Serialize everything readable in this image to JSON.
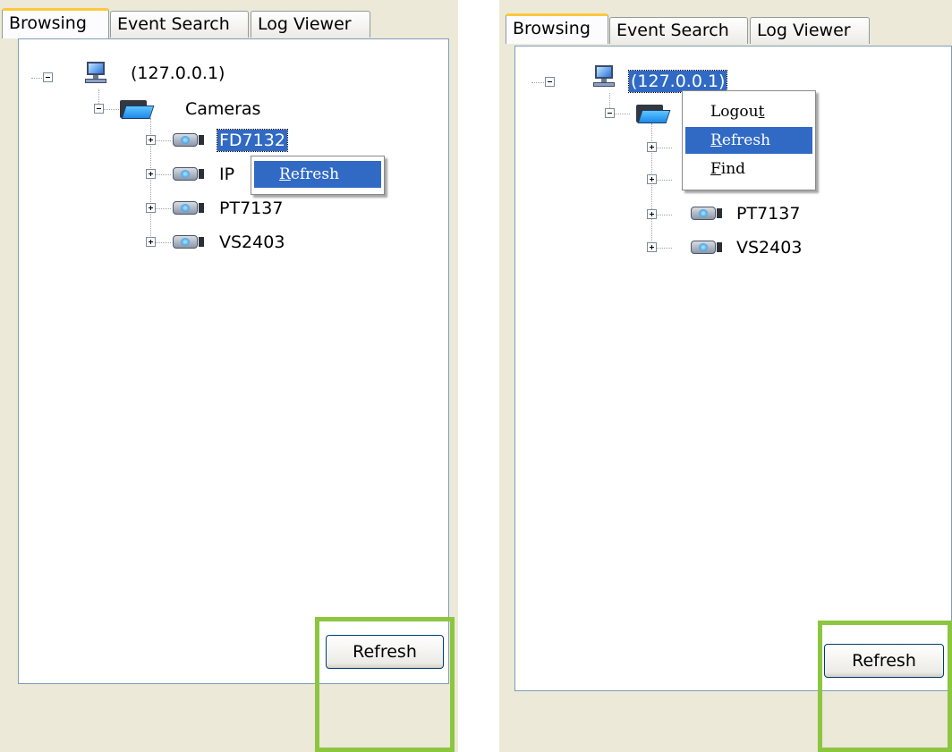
{
  "left_panel": {
    "tabs": [
      {
        "label": "Browsing",
        "active": true
      },
      {
        "label": "Event Search",
        "active": false
      },
      {
        "label": "Log Viewer",
        "active": false
      }
    ],
    "tree": {
      "server": {
        "label": "(127.0.0.1)",
        "icon": "computer-icon",
        "selected": false
      },
      "cameras_folder": {
        "label": "Cameras",
        "icon": "folder-icon"
      },
      "cameras": [
        {
          "label": "FD7132",
          "icon": "camera-icon",
          "selected": true
        },
        {
          "label": "IP",
          "icon": "camera-icon",
          "selected": false
        },
        {
          "label": "PT7137",
          "icon": "camera-icon",
          "selected": false
        },
        {
          "label": "VS2403",
          "icon": "camera-icon",
          "selected": false
        }
      ]
    },
    "context_menu": {
      "items": [
        {
          "label_accel": "R",
          "label_rest": "efresh",
          "highlighted": true
        }
      ]
    },
    "refresh_button": "Refresh"
  },
  "right_panel": {
    "tabs": [
      {
        "label": "Browsing",
        "active": true
      },
      {
        "label": "Event Search",
        "active": false
      },
      {
        "label": "Log Viewer",
        "active": false
      }
    ],
    "tree": {
      "server": {
        "label": "(127.0.0.1)",
        "icon": "computer-icon",
        "selected": true
      },
      "cameras_folder": {
        "icon": "folder-icon"
      },
      "cameras": [
        {
          "label": "PT7137",
          "icon": "camera-icon"
        },
        {
          "label": "VS2403",
          "icon": "camera-icon"
        }
      ]
    },
    "context_menu": {
      "items": [
        {
          "label_pre": "Logou",
          "label_accel": "t",
          "label_rest": "",
          "highlighted": false
        },
        {
          "label_pre": "",
          "label_accel": "R",
          "label_rest": "efresh",
          "highlighted": true
        },
        {
          "label_pre": "",
          "label_accel": "F",
          "label_rest": "ind",
          "highlighted": false
        }
      ]
    },
    "refresh_button": "Refresh"
  },
  "colors": {
    "panel_bg": "#ece9d8",
    "selection": "#316ac5",
    "highlight_frame": "#8cc63f",
    "active_tab_accent": "#ffc83c"
  }
}
